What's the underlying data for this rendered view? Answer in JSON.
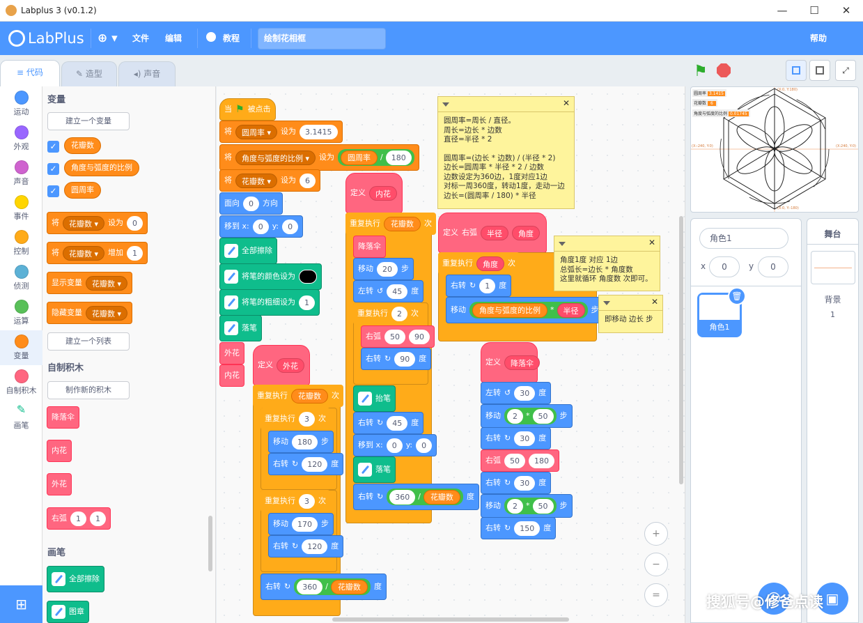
{
  "window": {
    "title": "Labplus 3 (v0.1.2)",
    "min": "—",
    "max": "☐",
    "close": "✕"
  },
  "menu": {
    "brand": "LabPlus",
    "globe": "⊕ ▾",
    "file": "文件",
    "edit": "编辑",
    "tutorial": "教程",
    "project_title": "绘制花相框",
    "help": "帮助"
  },
  "tabs": {
    "code": "代码",
    "costume": "造型",
    "sound": "声音"
  },
  "categories": [
    {
      "label": "运动",
      "color": "#4c97ff"
    },
    {
      "label": "外观",
      "color": "#9966ff"
    },
    {
      "label": "声音",
      "color": "#cf63cf"
    },
    {
      "label": "事件",
      "color": "#ffd500"
    },
    {
      "label": "控制",
      "color": "#ffab19"
    },
    {
      "label": "侦测",
      "color": "#5cb1d6"
    },
    {
      "label": "运算",
      "color": "#59c059"
    },
    {
      "label": "变量",
      "color": "#ff8c1a"
    },
    {
      "label": "自制积木",
      "color": "#ff6680"
    },
    {
      "label": "画笔",
      "color": "#0fbd8c"
    }
  ],
  "palette": {
    "variables_title": "变量",
    "make_var": "建立一个变量",
    "vars": [
      "花瓣数",
      "角度与弧度的比例",
      "圆周率"
    ],
    "set_label": "将",
    "set_var": "花瓣数",
    "set_to": "设为",
    "set_val": "0",
    "change_label": "将",
    "change_var": "花瓣数",
    "change_by": "增加",
    "change_val": "1",
    "show_label": "显示变量",
    "show_var": "花瓣数",
    "hide_label": "隐藏变量",
    "hide_var": "花瓣数",
    "make_list": "建立一个列表",
    "myblocks_title": "自制积木",
    "make_block": "制作新的积木",
    "custom": [
      "降落伞",
      "内花",
      "外花"
    ],
    "arc_label": "右弧",
    "arc_a": "1",
    "arc_b": "1",
    "pen_title": "画笔",
    "pen_clear": "全部擦除",
    "pen_stamp": "图章"
  },
  "script_main": {
    "hat": "当",
    "hat_clicked": "被点击",
    "s1_a": "将",
    "s1_var": "圆周率",
    "s1_b": "设为",
    "s1_val": "3.1415",
    "s2_a": "将",
    "s2_var": "角度与弧度的比例",
    "s2_b": "设为",
    "s2_op_var": "圆周率",
    "s2_op": "/",
    "s2_op_val": "180",
    "s3_a": "将",
    "s3_var": "花瓣数",
    "s3_b": "设为",
    "s3_val": "6",
    "dir_a": "面向",
    "dir_val": "0",
    "dir_b": "方向",
    "goto_a": "移到 x:",
    "goto_x": "0",
    "goto_y_label": "y:",
    "goto_y": "0",
    "clear": "全部擦除",
    "pencolor": "将笔的颜色设为",
    "pensize": "将笔的粗细设为",
    "pensize_val": "1",
    "pendown": "落笔",
    "call1": "外花",
    "call2": "内花"
  },
  "script_outer": {
    "define": "定义",
    "name": "外花",
    "repeat": "重复执行",
    "rep_var": "花瓣数",
    "times": "次",
    "r1": "重复执行",
    "r1_n": "3",
    "r1_times": "次",
    "m1": "移动",
    "m1_v": "180",
    "steps": "步",
    "t1": "右转",
    "t1_v": "120",
    "deg": "度",
    "r2": "重复执行",
    "r2_n": "3",
    "r2_times": "次",
    "m2": "移动",
    "m2_v": "170",
    "t2": "右转",
    "t2_v": "120",
    "t3": "右转",
    "t3_a": "360",
    "t3_op": "/",
    "t3_var": "花瓣数"
  },
  "script_inner": {
    "define": "定义",
    "name": "内花",
    "repeat": "重复执行",
    "rep_var": "花瓣数",
    "times": "次",
    "call": "降落伞",
    "m": "移动",
    "m_v": "20",
    "steps": "步",
    "l": "左转",
    "l_v": "45",
    "deg": "度",
    "r": "重复执行",
    "r_n": "2",
    "r_times": "次",
    "arc": "右弧",
    "arc_a": "50",
    "arc_b": "90",
    "t": "右转",
    "t_v": "90",
    "penup": "抬笔",
    "t2": "右转",
    "t2_v": "45",
    "goto": "移到 x:",
    "gx": "0",
    "gy_l": "y:",
    "gy": "0",
    "pendown": "落笔",
    "t3": "右转",
    "t3_a": "360",
    "t3_op": "/",
    "t3_var": "花瓣数"
  },
  "script_arc": {
    "define": "定义",
    "name": "右弧",
    "p1": "半径",
    "p2": "角度",
    "repeat": "重复执行",
    "rep_var": "角度",
    "times": "次",
    "t": "右转",
    "t_v": "1",
    "deg": "度",
    "m": "移动",
    "m_var": "角度与弧度的比例",
    "m_op": "*",
    "m_var2": "半径",
    "steps": "步"
  },
  "script_chute": {
    "define": "定义",
    "name": "降落伞",
    "l1": "左转",
    "l1_v": "30",
    "deg": "度",
    "m1": "移动",
    "m1_a": "2",
    "op": "*",
    "m1_b": "50",
    "steps": "步",
    "t1": "右转",
    "t1_v": "30",
    "arc": "右弧",
    "arc_a": "50",
    "arc_b": "180",
    "t2": "右转",
    "t2_v": "30",
    "m2": "移动",
    "m2_a": "2",
    "m2_b": "50",
    "t3": "右转",
    "t3_v": "150"
  },
  "notes": {
    "n1": [
      "圆周率=周长 / 直径。",
      "周长=边长 * 边数",
      "直径=半径 * 2",
      "",
      "圆周率=(边长 * 边数) / (半径 * 2)",
      "边长=圆周率 * 半径 * 2 / 边数",
      "边数设定为360边，1度对应1边",
      "对标一周360度，转动1度，走动一边",
      "边长=(圆周率 / 180) * 半径"
    ],
    "n2": [
      "角度1度 对应 1边",
      "总弧长=边长 * 角度数",
      "这里就循环 角度数 次即可。"
    ],
    "n3": [
      "即移动 边长 步"
    ]
  },
  "stage_monitors": [
    {
      "name": "圆周率",
      "value": "3.1415"
    },
    {
      "name": "花瓣数",
      "value": "6"
    },
    {
      "name": "角度与弧度的比例",
      "value": "0.01745"
    }
  ],
  "stage_axes": {
    "top": "(X:0, Y:180)",
    "left": "(X:-240, Y:0)",
    "right": "(X:240, Y:0)",
    "bottom": "(X:0, Y:-180)"
  },
  "sprite": {
    "label": "角色1",
    "name": "角色1",
    "x_label": "x",
    "x": "0",
    "y_label": "y",
    "y": "0"
  },
  "stage_panel": {
    "title": "舞台",
    "backdrop": "背景",
    "count": "1"
  },
  "zoom": {
    "in": "+",
    "out": "−",
    "reset": "="
  },
  "watermark": "搜狐号@修爸点读",
  "colors": {
    "accent": "#4c97ff",
    "variables": "#ff8c1a",
    "myblocks": "#ff6680",
    "pen": "#0fbd8c",
    "control": "#ffab19",
    "operators": "#59c059"
  }
}
